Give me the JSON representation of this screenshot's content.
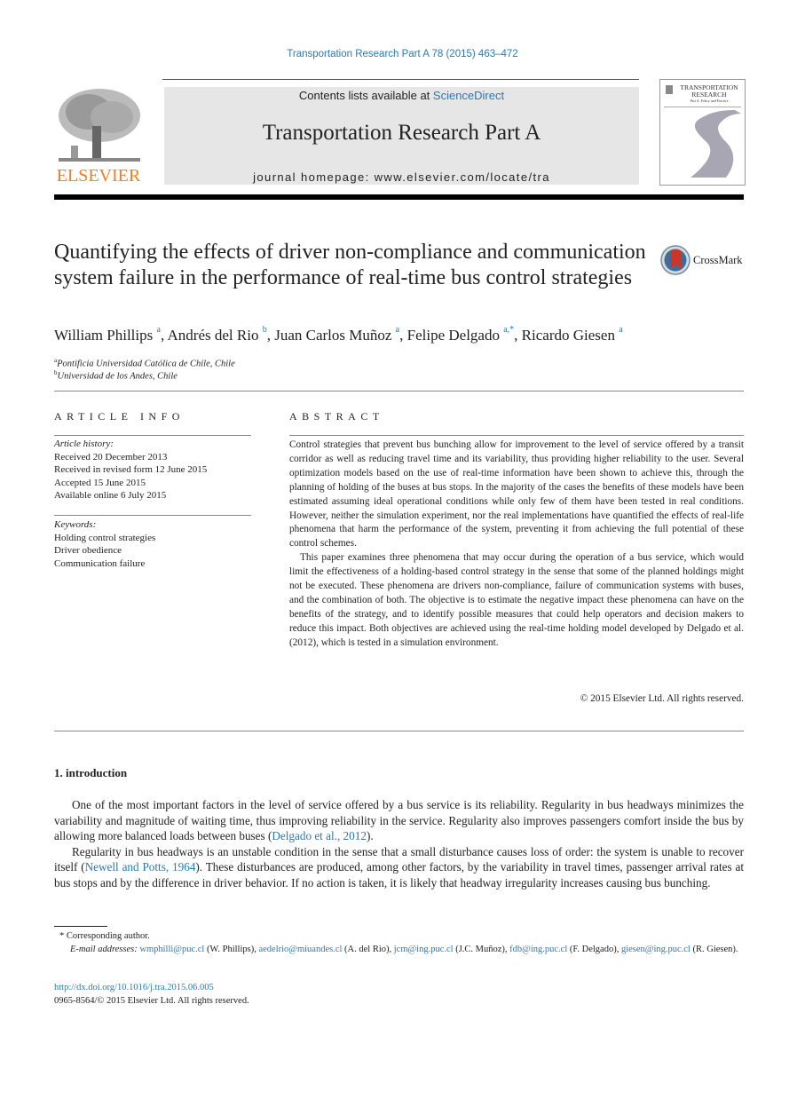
{
  "header": {
    "journal_ref": "Transportation Research Part A 78 (2015) 463–472",
    "contents_prefix": "Contents lists available at ",
    "contents_link": "ScienceDirect",
    "journal_title": "Transportation Research Part A",
    "homepage_prefix": "journal homepage: ",
    "homepage_url": "www.elsevier.com/locate/tra",
    "publisher_logo_text": "ELSEVIER",
    "cover_title_line1": "TRANSPORTATION",
    "cover_title_line2": "RESEARCH",
    "cover_subtitle": "Part A: Policy and Practice"
  },
  "article": {
    "title": "Quantifying the effects of driver non-compliance and communication system failure in the performance of real-time bus control strategies",
    "crossmark_label": "CrossMark",
    "authors": [
      {
        "name": "William Phillips",
        "sup": "a"
      },
      {
        "name": "Andrés del Rio",
        "sup": "b"
      },
      {
        "name": "Juan Carlos Muñoz",
        "sup": "a"
      },
      {
        "name": "Felipe Delgado",
        "sup": "a,*"
      },
      {
        "name": "Ricardo Giesen",
        "sup": "a"
      }
    ],
    "affiliations": [
      {
        "sup": "a",
        "text": "Pontificia Universidad Católica de Chile, Chile"
      },
      {
        "sup": "b",
        "text": "Universidad de los Andes, Chile"
      }
    ]
  },
  "article_info": {
    "heading": "ARTICLE INFO",
    "history_label": "Article history:",
    "history": [
      "Received 20 December 2013",
      "Received in revised form 12 June 2015",
      "Accepted 15 June 2015",
      "Available online 6 July 2015"
    ],
    "keywords_label": "Keywords:",
    "keywords": [
      "Holding control strategies",
      "Driver obedience",
      "Communication failure"
    ]
  },
  "abstract": {
    "heading": "ABSTRACT",
    "paragraphs": [
      "Control strategies that prevent bus bunching allow for improvement to the level of service offered by a transit corridor as well as reducing travel time and its variability, thus providing higher reliability to the user. Several optimization models based on the use of real-time information have been shown to achieve this, through the planning of holding of the buses at bus stops. In the majority of the cases the benefits of these models have been estimated assuming ideal operational conditions while only few of them have been tested in real conditions. However, neither the simulation experiment, nor the real implementations have quantified the effects of real-life phenomena that harm the performance of the system, preventing it from achieving the full potential of these control schemes.",
      "This paper examines three phenomena that may occur during the operation of a bus service, which would limit the effectiveness of a holding-based control strategy in the sense that some of the planned holdings might not be executed. These phenomena are drivers non-compliance, failure of communication systems with buses, and the combination of both. The objective is to estimate the negative impact these phenomena can have on the benefits of the strategy, and to identify possible measures that could help operators and decision makers to reduce this impact. Both objectives are achieved using the real-time holding model developed by Delgado et al. (2012), which is tested in a simulation environment."
    ],
    "copyright": "© 2015 Elsevier Ltd. All rights reserved."
  },
  "section1": {
    "heading": "1. introduction",
    "p1_text": "One of the most important factors in the level of service offered by a bus service is its reliability. Regularity in bus headways minimizes the variability and magnitude of waiting time, thus improving reliability in the service. Regularity also improves passengers comfort inside the bus by allowing more balanced loads between buses (",
    "p1_link": "Delgado et al., 2012",
    "p1_end": ").",
    "p2_text": "Regularity in bus headways is an unstable condition in the sense that a small disturbance causes loss of order: the system is unable to recover itself (",
    "p2_link": "Newell and Potts, 1964",
    "p2_end": "). These disturbances are produced, among other factors, by the variability in travel times, passenger arrival rates at bus stops and by the difference in driver behavior. If no action is taken, it is likely that headway irregularity increases causing bus bunching."
  },
  "footnotes": {
    "corresponding": "* Corresponding author.",
    "email_label": "E-mail addresses:",
    "emails": [
      {
        "email": "wmphilli@puc.cl",
        "name": " (W. Phillips), "
      },
      {
        "email": "aedelrio@miuandes.cl",
        "name": " (A. del Rio), "
      },
      {
        "email": "jcm@ing.puc.cl",
        "name": " (J.C. Muñoz), "
      },
      {
        "email": "fdb@ing.puc.cl",
        "name": " (F. Delgado), "
      },
      {
        "email": "giesen@ing.puc.cl",
        "name": " (R. Giesen)."
      }
    ],
    "doi": "http://dx.doi.org/10.1016/j.tra.2015.06.005",
    "issn": "0965-8564/© 2015 Elsevier Ltd. All rights reserved."
  }
}
